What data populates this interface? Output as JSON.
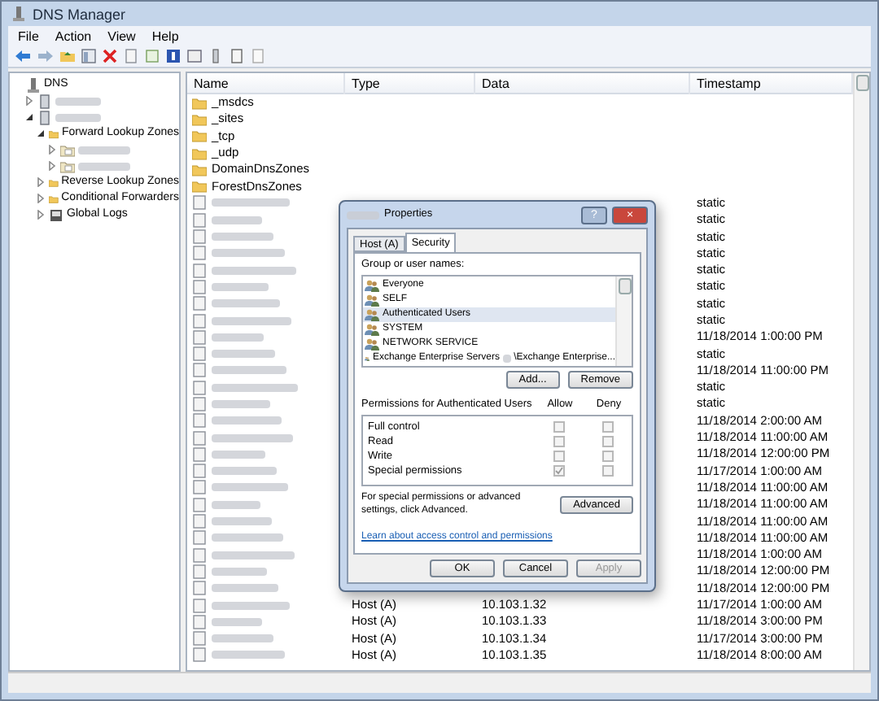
{
  "window": {
    "title": "DNS Manager"
  },
  "menu": [
    "File",
    "Action",
    "View",
    "Help"
  ],
  "tree": [
    {
      "label": "DNS",
      "kind": "dns",
      "children": [
        {
          "kind": "server",
          "expanded": false
        },
        {
          "kind": "server",
          "expanded": true,
          "children": [
            {
              "label": "Forward Lookup Zones",
              "kind": "folder",
              "expanded": true,
              "children": [
                {
                  "kind": "zone",
                  "expanded": false
                },
                {
                  "kind": "zone",
                  "expanded": false
                }
              ]
            },
            {
              "label": "Reverse Lookup Zones",
              "kind": "folder",
              "expanded": false
            },
            {
              "label": "Conditional Forwarders",
              "kind": "folder",
              "expanded": false
            },
            {
              "label": "Global Logs",
              "kind": "logs",
              "expanded": false
            }
          ]
        }
      ]
    }
  ],
  "list": {
    "columns": [
      "Name",
      "Type",
      "Data",
      "Timestamp"
    ],
    "rows": [
      {
        "kind": "folder",
        "name": "_msdcs"
      },
      {
        "kind": "folder",
        "name": "_sites"
      },
      {
        "kind": "folder",
        "name": "_tcp"
      },
      {
        "kind": "folder",
        "name": "_udp"
      },
      {
        "kind": "folder",
        "name": "DomainDnsZones"
      },
      {
        "kind": "folder",
        "name": "ForestDnsZones"
      },
      {
        "kind": "record",
        "timestamp": "static"
      },
      {
        "kind": "record",
        "timestamp": "static"
      },
      {
        "kind": "record",
        "timestamp": "static"
      },
      {
        "kind": "record",
        "timestamp": "static"
      },
      {
        "kind": "record",
        "timestamp": "static"
      },
      {
        "kind": "record",
        "timestamp": "static"
      },
      {
        "kind": "record",
        "timestamp": "static"
      },
      {
        "kind": "record",
        "timestamp": "static"
      },
      {
        "kind": "record",
        "timestamp": "11/18/2014 1:00:00 PM"
      },
      {
        "kind": "record",
        "timestamp": "static"
      },
      {
        "kind": "record",
        "timestamp": "11/18/2014 11:00:00 PM"
      },
      {
        "kind": "record",
        "timestamp": "static"
      },
      {
        "kind": "record",
        "timestamp": "static"
      },
      {
        "kind": "record",
        "timestamp": "11/18/2014 2:00:00 AM"
      },
      {
        "kind": "record",
        "timestamp": "11/18/2014 11:00:00 AM"
      },
      {
        "kind": "record",
        "timestamp": "11/18/2014 12:00:00 PM"
      },
      {
        "kind": "record",
        "timestamp": "11/17/2014 1:00:00 AM"
      },
      {
        "kind": "record",
        "timestamp": "11/18/2014 11:00:00 AM"
      },
      {
        "kind": "record",
        "timestamp": "11/18/2014 11:00:00 AM"
      },
      {
        "kind": "record",
        "timestamp": "11/18/2014 11:00:00 AM"
      },
      {
        "kind": "record",
        "timestamp": "11/18/2014 11:00:00 AM"
      },
      {
        "kind": "record",
        "timestamp": "11/18/2014 1:00:00 AM"
      },
      {
        "kind": "record",
        "timestamp": "11/18/2014 12:00:00 PM"
      },
      {
        "kind": "record",
        "timestamp": "11/18/2014 12:00:00 PM"
      },
      {
        "kind": "record",
        "type": "Host (A)",
        "data": "10.103.1.32",
        "timestamp": "11/17/2014 1:00:00 AM"
      },
      {
        "kind": "record",
        "type": "Host (A)",
        "data": "10.103.1.33",
        "timestamp": "11/18/2014 3:00:00 PM"
      },
      {
        "kind": "record",
        "type": "Host (A)",
        "data": "10.103.1.34",
        "timestamp": "11/17/2014 3:00:00 PM"
      },
      {
        "kind": "record",
        "type": "Host (A)",
        "data": "10.103.1.35",
        "timestamp": "11/18/2014 8:00:00 AM"
      }
    ]
  },
  "dialog": {
    "title": "Properties",
    "help": "?",
    "close": "×",
    "tabs": [
      {
        "label": "Host (A)",
        "selected": false
      },
      {
        "label": "Security",
        "selected": true
      }
    ],
    "group_label": "Group or user names:",
    "groups": [
      {
        "name": "Everyone",
        "selected": false
      },
      {
        "name": "SELF",
        "selected": false
      },
      {
        "name": "Authenticated Users",
        "selected": true
      },
      {
        "name": "SYSTEM",
        "selected": false
      },
      {
        "name": "NETWORK SERVICE",
        "selected": false
      },
      {
        "name": "Exchange Enterprise Servers",
        "suffix": "\\Exchange Enterprise...",
        "selected": false
      }
    ],
    "add": "Add...",
    "remove": "Remove",
    "permissions_label": "Permissions for Authenticated Users",
    "allow_label": "Allow",
    "deny_label": "Deny",
    "permissions": [
      {
        "label": "Full control",
        "allow": false,
        "deny": false,
        "disabled": true
      },
      {
        "label": "Read",
        "allow": false,
        "deny": false,
        "disabled": true
      },
      {
        "label": "Write",
        "allow": false,
        "deny": false,
        "disabled": true
      },
      {
        "label": "Special permissions",
        "allow": true,
        "deny": false,
        "disabled": true
      }
    ],
    "advanced_text": "For special permissions or advanced settings, click Advanced.",
    "advanced": "Advanced",
    "link": "Learn about access control and permissions",
    "buttons": [
      {
        "label": "OK",
        "disabled": false
      },
      {
        "label": "Cancel",
        "disabled": false
      },
      {
        "label": "Apply",
        "disabled": true
      }
    ]
  }
}
